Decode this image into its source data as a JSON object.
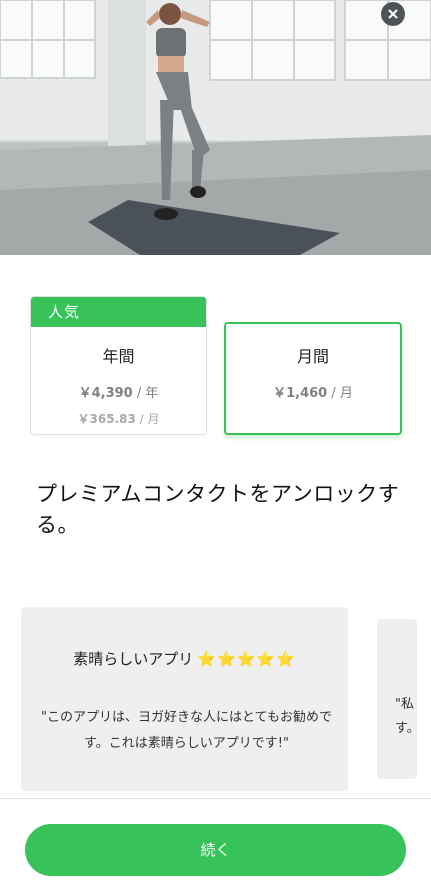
{
  "hero": {
    "image": "woman-workout-on-mat-photo"
  },
  "close_button": {
    "icon": "close-icon"
  },
  "plans": [
    {
      "badge": "人気",
      "title": "年間",
      "price": "￥4,390",
      "price_unit": " / 年",
      "subprice": "￥365.83",
      "subprice_unit": " / 月",
      "selected": false
    },
    {
      "title": "月間",
      "price": "￥1,460",
      "price_unit": " / 月",
      "selected": true
    }
  ],
  "headline": "プレミアムコンタクトをアンロックする。",
  "reviews": [
    {
      "title": "素晴らしいアプリ",
      "stars": "⭐⭐⭐⭐⭐",
      "body": "\"このアプリは、ヨガ好きな人にはとてもお勧めです。これは素晴らしいアプリです!\""
    },
    {
      "body_line1": "\"私",
      "body_line2": "す。"
    }
  ],
  "continue_label": "続く",
  "colors": {
    "accent": "#38c35a",
    "star": "#f7c325",
    "card_bg": "#efefef"
  }
}
